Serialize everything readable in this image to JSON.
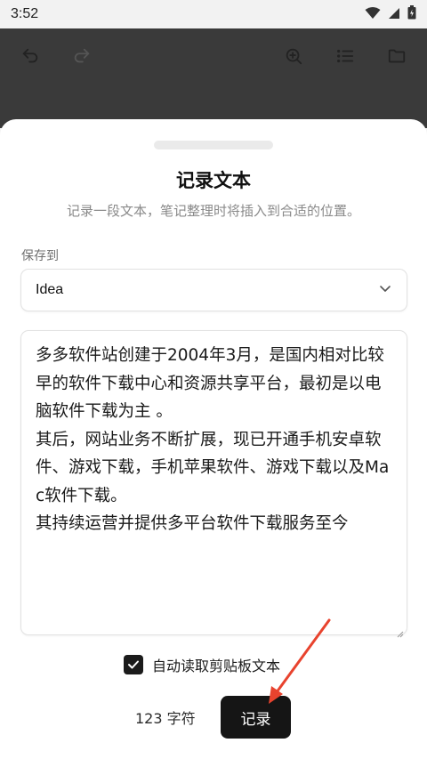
{
  "status_bar": {
    "time": "3:52",
    "icons": [
      "wifi-icon",
      "signal-icon",
      "battery-icon"
    ]
  },
  "toolbar": {
    "left_icons": [
      "undo-icon",
      "redo-icon"
    ],
    "right_icons": [
      "search-zoom-icon",
      "list-icon",
      "folder-icon"
    ]
  },
  "sheet": {
    "title": "记录文本",
    "subtitle": "记录一段文本，笔记整理时将插入到合适的位置。",
    "save_to_label": "保存到",
    "save_to_value": "Idea",
    "text_content": "多多软件站创建于2004年3月，是国内相对比较早的软件下载中心和资源共享平台，最初是以电脑软件下载为主 。\n其后，网站业务不断扩展，现已开通手机安卓软件、游戏下载，手机苹果软件、游戏下载以及Mac软件下载。\n其持续运营并提供多平台软件下载服务至今",
    "auto_read_checked": true,
    "auto_read_label": "自动读取剪贴板文本",
    "char_count": "123 字符",
    "record_label": "记录"
  },
  "colors": {
    "toolbar_bg": "#3a3a3a",
    "primary_button": "#151515",
    "annotation_arrow": "#e8432e"
  }
}
